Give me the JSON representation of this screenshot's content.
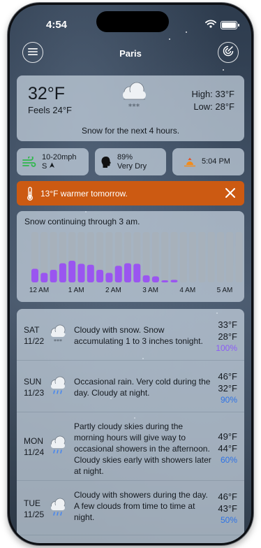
{
  "status_bar": {
    "time": "4:54"
  },
  "header": {
    "city": "Paris"
  },
  "current": {
    "temp": "32°F",
    "feels_like": "Feels 24°F",
    "high": "High: 33°F",
    "low": "Low: 28°F",
    "summary": "Snow for the next 4 hours.",
    "icon": "snow-cloud-icon"
  },
  "mini": {
    "wind_speed": "10-20mph",
    "wind_dir": "S",
    "humidity": "89%",
    "humidity_desc": "Very Dry",
    "sunset": "5:04 PM"
  },
  "alert": {
    "text": "13°F warmer tomorrow.",
    "color": "#cc5a12"
  },
  "hourly": {
    "title": "Snow continuing through 3 am.",
    "labels": [
      "12 AM",
      "1 AM",
      "2 AM",
      "3 AM",
      "4 AM",
      "5 AM"
    ],
    "precip_levels": [
      0.27,
      0.19,
      0.25,
      0.38,
      0.43,
      0.37,
      0.35,
      0.25,
      0.19,
      0.33,
      0.38,
      0.37,
      0.14,
      0.12,
      0.04,
      0.05,
      0,
      0,
      0,
      0,
      0,
      0,
      0,
      0
    ],
    "bar_color": "#9a55f0",
    "track_color": "#a7b1bb"
  },
  "forecast": [
    {
      "dow": "SAT",
      "date": "11/22",
      "text": "Cloudy with snow. Snow accumulating 1 to 3 inches tonight.",
      "high": "33°F",
      "low": "28°F",
      "precip": "100%",
      "precip_type": "snow",
      "icon": "snow-cloud-icon"
    },
    {
      "dow": "SUN",
      "date": "11/23",
      "text": "Occasional rain. Very cold during the day. Cloudy at night.",
      "high": "46°F",
      "low": "32°F",
      "precip": "90%",
      "precip_type": "rain",
      "icon": "rain-cloud-icon"
    },
    {
      "dow": "MON",
      "date": "11/24",
      "text": "Partly cloudy skies during the morning hours will give way to occasional showers in the afternoon. Cloudy skies early with showers later at night.",
      "high": "49°F",
      "low": "44°F",
      "precip": "60%",
      "precip_type": "rain",
      "icon": "rain-cloud-icon"
    },
    {
      "dow": "TUE",
      "date": "11/25",
      "text": "Cloudy with showers during the day. A few clouds from time to time at night.",
      "high": "46°F",
      "low": "43°F",
      "precip": "50%",
      "precip_type": "rain",
      "icon": "rain-cloud-icon"
    }
  ]
}
